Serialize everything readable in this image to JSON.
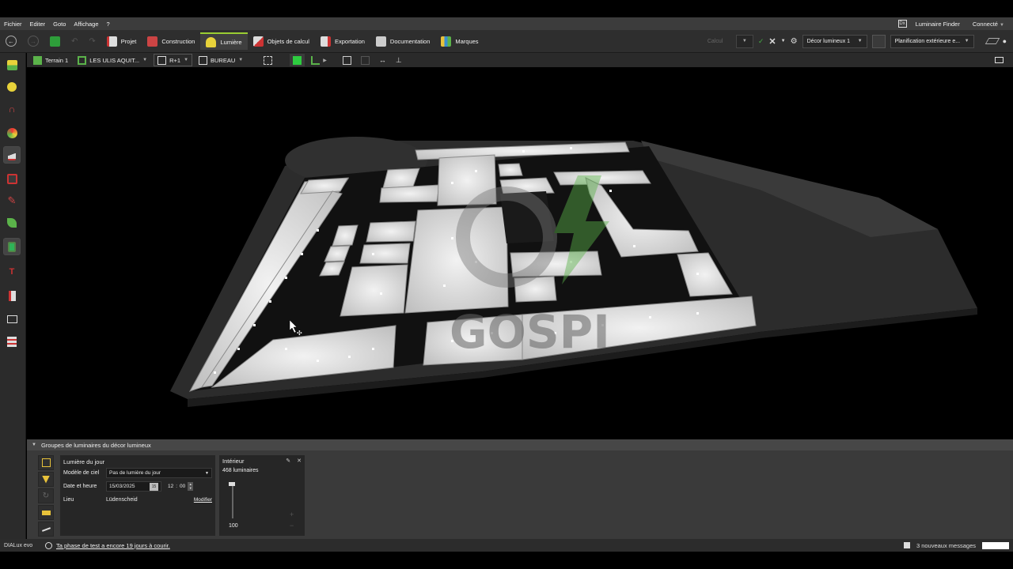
{
  "menu": {
    "items": [
      "Fichier",
      "Editer",
      "Goto",
      "Affichage",
      "?"
    ],
    "luminaire_finder": "Luminaire Finder",
    "luminaire_finder_icon": "Dx",
    "connected": "Connecté"
  },
  "toolbar": {
    "tabs": [
      {
        "label": "Projet",
        "icon": "project-icon"
      },
      {
        "label": "Construction",
        "icon": "construction-icon"
      },
      {
        "label": "Lumière",
        "icon": "light-icon"
      },
      {
        "label": "Objets de calcul",
        "icon": "calc-objects-icon"
      },
      {
        "label": "Exportation",
        "icon": "export-icon"
      },
      {
        "label": "Documentation",
        "icon": "documentation-icon"
      },
      {
        "label": "Marques",
        "icon": "brands-icon"
      }
    ],
    "active_tab": "Lumière",
    "calc_label": "Calcul",
    "light_scene": "Décor lumineux 1",
    "exterior_planning": "Planification extérieure e..."
  },
  "toolbar2": {
    "terrain": "Terrain 1",
    "building": "LES ULIS AQUIT...",
    "level": "R+1",
    "room": "BUREAU"
  },
  "panel": {
    "title": "Groupes de luminaires du décor lumineux",
    "daylight": {
      "title": "Lumière du jour",
      "sky_model_label": "Modèle de ciel",
      "sky_model_value": "Pas de lumière du jour",
      "date_label": "Date et heure",
      "date_value": "15/03/2025",
      "calendar_day": "15",
      "hour": "12",
      "minute": "00",
      "location_label": "Lieu",
      "location_value": "Lüdenscheid",
      "modify_link": "Modifier"
    },
    "interior": {
      "title": "Intérieur",
      "count": "468 luminaires",
      "dimmer_value": "100",
      "dimmer_fraction": 1.0
    }
  },
  "watermark": {
    "text": "GOSPI"
  },
  "status": {
    "brand": "DIALux evo",
    "trial": "Ta phase de test a encore 19 jours à courir.",
    "messages": "3 nouveaux messages"
  },
  "colors": {
    "accent": "#9acd32",
    "background": "#000000",
    "panel": "#3a3a3a"
  }
}
